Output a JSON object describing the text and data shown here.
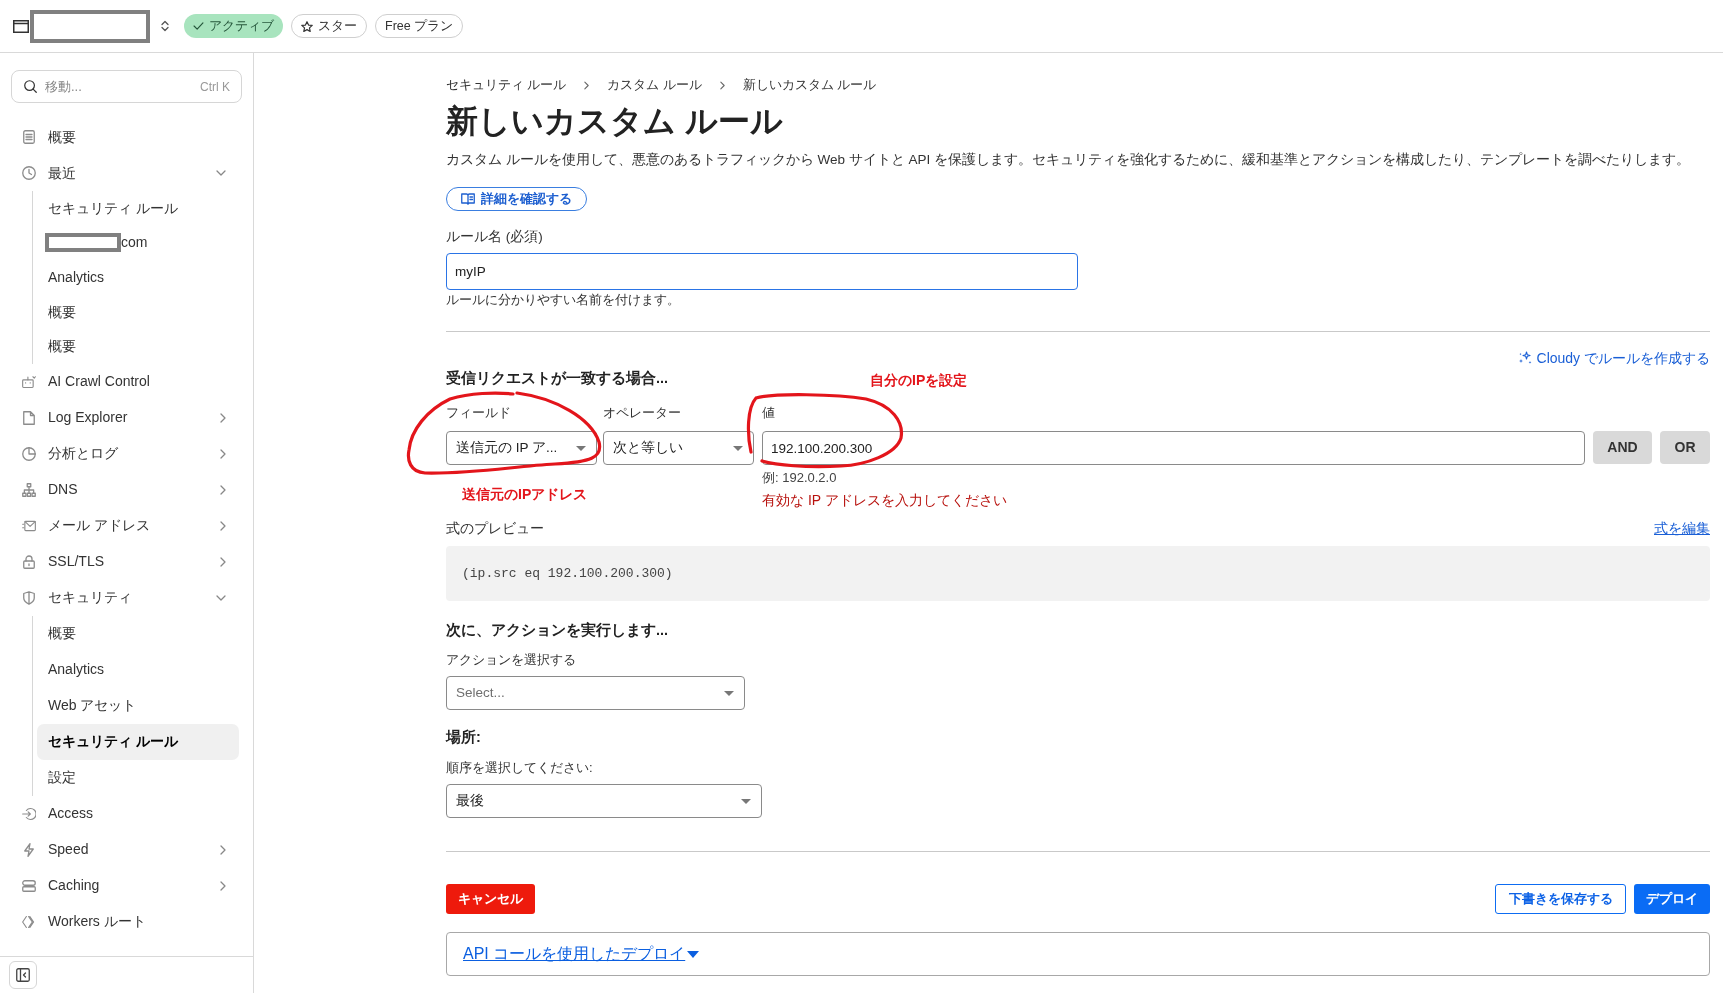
{
  "top_bar": {
    "account_switcher": {
      "redacted": true
    },
    "badges": [
      {
        "kind": "status",
        "label": "アクティブ"
      },
      {
        "kind": "star",
        "label": "スター"
      },
      {
        "kind": "plan",
        "label": "Free プラン"
      }
    ]
  },
  "sidebar": {
    "search": {
      "placeholder": "移動...",
      "shortcut": "Ctrl K"
    },
    "items": [
      {
        "label": "概要",
        "selected": false
      },
      {
        "label": "最近",
        "selected": false,
        "expanded": true,
        "children": [
          {
            "label": "セキュリティ ルール",
            "selected": false
          },
          {
            "label": "com",
            "selected": false,
            "redacted": true
          },
          {
            "label": "Analytics",
            "selected": false
          },
          {
            "label": "概要",
            "selected": false
          },
          {
            "label": "概要",
            "selected": false
          }
        ]
      },
      {
        "label": "AI Crawl Control",
        "selected": false
      },
      {
        "label": "Log Explorer",
        "selected": false,
        "expanded": false
      },
      {
        "label": "分析とログ",
        "selected": false,
        "expanded": false
      },
      {
        "label": "DNS",
        "selected": false,
        "expanded": false
      },
      {
        "label": "メール アドレス",
        "selected": false,
        "expanded": false
      },
      {
        "label": "SSL/TLS",
        "selected": false,
        "expanded": false
      },
      {
        "label": "セキュリティ",
        "selected": false,
        "expanded": true,
        "children": [
          {
            "label": "概要",
            "selected": false
          },
          {
            "label": "Analytics",
            "selected": false
          },
          {
            "label": "Web アセット",
            "selected": false
          },
          {
            "label": "セキュリティ ルール",
            "selected": true
          },
          {
            "label": "設定",
            "selected": false
          }
        ]
      },
      {
        "label": "Access",
        "selected": false
      },
      {
        "label": "Speed",
        "selected": false,
        "expanded": false
      },
      {
        "label": "Caching",
        "selected": false,
        "expanded": false
      },
      {
        "label": "Workers ルート",
        "selected": false
      }
    ]
  },
  "main": {
    "breadcrumb": [
      "セキュリティ ルール",
      "カスタム ルール",
      "新しいカスタム ルール"
    ],
    "title": "新しいカスタム ルール",
    "description": "カスタム ルールを使用して、悪意のあるトラフィックから Web サイトと API を保護します。セキュリティを強化するために、緩和基準とアクションを構成したり、テンプレートを調べたりします。",
    "learn_more_button": "詳細を確認する",
    "rule_name": {
      "label": "ルール名 (必須)",
      "value": "myIP",
      "help": "ルールに分かりやすい名前を付けます。"
    },
    "match_section": {
      "cloudy_link": "Cloudy でルールを作成する",
      "heading": "受信リクエストが一致する場合...",
      "field": {
        "label": "フィールド",
        "value": "送信元の IP ア..."
      },
      "operator": {
        "label": "オペレーター",
        "value": "次と等しい"
      },
      "value": {
        "label": "値",
        "value": "192.100.200.300",
        "hint": "例: 192.0.2.0",
        "error": "有効な IP アドレスを入力してください"
      },
      "logic_buttons": [
        "AND",
        "OR"
      ],
      "annotations": [
        "自分のIPを設定",
        "送信元のIPアドレス"
      ]
    },
    "expression_preview": {
      "label": "式のプレビュー",
      "edit_link": "式を編集",
      "code": "(ip.src eq 192.100.200.300)"
    },
    "action_section": {
      "heading": "次に、アクションを実行します...",
      "label": "アクションを選択する",
      "placeholder": "Select..."
    },
    "placement": {
      "heading": "場所:",
      "label": "順序を選択してください:",
      "value": "最後"
    },
    "buttons": [
      {
        "kind": "cancel",
        "label": "キャンセル"
      },
      {
        "kind": "secondary",
        "label": "下書きを保存する"
      },
      {
        "kind": "primary",
        "label": "デプロイ"
      }
    ],
    "api_deploy": {
      "label": "API コールを使用したデプロイ"
    }
  }
}
